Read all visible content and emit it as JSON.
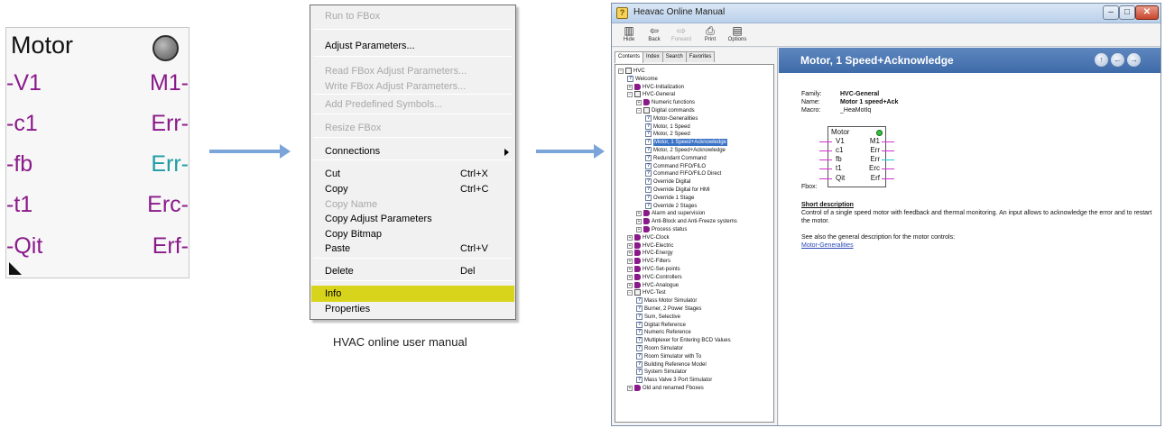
{
  "fbox": {
    "title": "Motor",
    "inputs": [
      "-V1",
      "-c1",
      "-fb",
      "-t1",
      "-Qit"
    ],
    "outputs": [
      {
        "label": "M1-",
        "color": "#8a1a8a"
      },
      {
        "label": "Err-",
        "color": "#8a1a8a"
      },
      {
        "label": "Err-",
        "color": "#1e9ca5"
      },
      {
        "label": "Erc-",
        "color": "#8a1a8a"
      },
      {
        "label": "Erf-",
        "color": "#8a1a8a"
      }
    ],
    "input_color": "#8a1a8a"
  },
  "context_menu": {
    "items": [
      {
        "label": "Run to FBox",
        "disabled": true
      },
      {
        "label": "Adjust Parameters...",
        "disabled": false
      },
      {
        "label": "Read FBox Adjust Parameters...",
        "disabled": true
      },
      {
        "label": "Write FBox Adjust Parameters...",
        "disabled": true
      },
      {
        "label": "Add Predefined Symbols...",
        "disabled": true
      },
      {
        "label": "Resize FBox",
        "disabled": true
      },
      {
        "label": "Connections",
        "disabled": false,
        "submenu": true
      },
      {
        "label": "Cut",
        "shortcut": "Ctrl+X",
        "disabled": false
      },
      {
        "label": "Copy",
        "shortcut": "Ctrl+C",
        "disabled": false
      },
      {
        "label": "Copy Name",
        "disabled": true
      },
      {
        "label": "Copy Adjust Parameters",
        "disabled": false
      },
      {
        "label": "Copy Bitmap",
        "disabled": false
      },
      {
        "label": "Paste",
        "shortcut": "Ctrl+V",
        "disabled": false
      },
      {
        "label": "Delete",
        "shortcut": "Del",
        "disabled": false
      },
      {
        "label": "Info",
        "disabled": false,
        "highlighted": true
      },
      {
        "label": "Properties",
        "disabled": false
      }
    ],
    "highlight_color": "#d8d41c"
  },
  "caption": "HVAC online user manual",
  "help_window": {
    "title": "Heavac Online Manual",
    "window_buttons": {
      "minimize": "–",
      "maximize": "□",
      "close": "✕"
    },
    "toolbar": [
      {
        "label": "Hide",
        "icon": "hide-icon",
        "glyph": "▥",
        "disabled": false
      },
      {
        "label": "Back",
        "icon": "back-arrow-icon",
        "glyph": "⇦",
        "disabled": false
      },
      {
        "label": "Forward",
        "icon": "forward-arrow-icon",
        "glyph": "⇨",
        "disabled": true
      },
      {
        "label": "Print",
        "icon": "printer-icon",
        "glyph": "⎙",
        "disabled": false
      },
      {
        "label": "Options",
        "icon": "options-icon",
        "glyph": "▤",
        "disabled": false
      }
    ],
    "tabs": [
      {
        "label": "Contents",
        "active": true
      },
      {
        "label": "Index",
        "active": false
      },
      {
        "label": "Search",
        "active": false
      },
      {
        "label": "Favorites",
        "active": false
      }
    ],
    "tree": [
      {
        "label": "HVC",
        "level": 0,
        "icon": "open",
        "exp": "−"
      },
      {
        "label": "Welcome",
        "level": 1,
        "icon": "page"
      },
      {
        "label": "HVC-Initialization",
        "level": 1,
        "icon": "book",
        "exp": "+"
      },
      {
        "label": "HVC-General",
        "level": 1,
        "icon": "open",
        "exp": "−"
      },
      {
        "label": "Numeric functions",
        "level": 2,
        "icon": "book",
        "exp": "+"
      },
      {
        "label": "Digital commands",
        "level": 2,
        "icon": "open",
        "exp": "−"
      },
      {
        "label": "Motor-Generalities",
        "level": 3,
        "icon": "page"
      },
      {
        "label": "Motor, 1 Speed",
        "level": 3,
        "icon": "page"
      },
      {
        "label": "Motor, 2 Speed",
        "level": 3,
        "icon": "page"
      },
      {
        "label": "Motor, 1 Speed+Acknowledge",
        "level": 3,
        "icon": "page",
        "selected": true
      },
      {
        "label": "Motor, 2 Speed+Acknowledge",
        "level": 3,
        "icon": "page"
      },
      {
        "label": "Redundant Command",
        "level": 3,
        "icon": "page"
      },
      {
        "label": "Command FIFO/FILO",
        "level": 3,
        "icon": "page"
      },
      {
        "label": "Command FIFO/FILO Direct",
        "level": 3,
        "icon": "page"
      },
      {
        "label": "Override Digital",
        "level": 3,
        "icon": "page"
      },
      {
        "label": "Override Digital for HMI",
        "level": 3,
        "icon": "page"
      },
      {
        "label": "Override 1 Stage",
        "level": 3,
        "icon": "page"
      },
      {
        "label": "Override 2 Stages",
        "level": 3,
        "icon": "page"
      },
      {
        "label": "Alarm and supervision",
        "level": 2,
        "icon": "book",
        "exp": "+"
      },
      {
        "label": "Anti-Block and Anti-Freeze systems",
        "level": 2,
        "icon": "book",
        "exp": "+"
      },
      {
        "label": "Process status",
        "level": 2,
        "icon": "book",
        "exp": "+"
      },
      {
        "label": "HVC-Clock",
        "level": 1,
        "icon": "book",
        "exp": "+"
      },
      {
        "label": "HVC-Electric",
        "level": 1,
        "icon": "book",
        "exp": "+"
      },
      {
        "label": "HVC-Energy",
        "level": 1,
        "icon": "book",
        "exp": "+"
      },
      {
        "label": "HVC-Filters",
        "level": 1,
        "icon": "book",
        "exp": "+"
      },
      {
        "label": "HVC-Set-points",
        "level": 1,
        "icon": "book",
        "exp": "+"
      },
      {
        "label": "HVC-Controllers",
        "level": 1,
        "icon": "book",
        "exp": "+"
      },
      {
        "label": "HVC-Analogue",
        "level": 1,
        "icon": "book",
        "exp": "+"
      },
      {
        "label": "HVC-Test",
        "level": 1,
        "icon": "open",
        "exp": "−"
      },
      {
        "label": "Mass Motor Simulator",
        "level": 2,
        "icon": "page"
      },
      {
        "label": "Burner, 2 Power Stages",
        "level": 2,
        "icon": "page"
      },
      {
        "label": "Sum, Selective",
        "level": 2,
        "icon": "page"
      },
      {
        "label": "Digital Reference",
        "level": 2,
        "icon": "page"
      },
      {
        "label": "Numeric Reference",
        "level": 2,
        "icon": "page"
      },
      {
        "label": "Multiplexer for Entering BCD Values",
        "level": 2,
        "icon": "page"
      },
      {
        "label": "Room Simulator",
        "level": 2,
        "icon": "page"
      },
      {
        "label": "Room Simulator with To",
        "level": 2,
        "icon": "page"
      },
      {
        "label": "Building Reference Model",
        "level": 2,
        "icon": "page"
      },
      {
        "label": "System Simulator",
        "level": 2,
        "icon": "page"
      },
      {
        "label": "Mass Valve 3 Port Simulator",
        "level": 2,
        "icon": "page"
      },
      {
        "label": "Old and renamed Fboxes",
        "level": 1,
        "icon": "book",
        "exp": "+"
      }
    ],
    "topic": {
      "title": "Motor, 1 Speed+Acknowledge",
      "family_label": "Family:",
      "family_value": "HVC-General",
      "name_label": "Name:",
      "name_value": "Motor 1 speed+Ack",
      "macro_label": "Macro:",
      "macro_value": "_HeaMotIq",
      "fbox_label": "Fbox:",
      "short_desc_head": "Short description",
      "short_desc": "Control of a single speed motor with feedback and thermal monitoring. An input allows to acknowledge the error and to restart the motor.",
      "see_also": "See also the general description for the motor controls:",
      "link": "Motor-Generalities",
      "mini_fbox": {
        "title": "Motor",
        "inputs": [
          "V1",
          "c1",
          "fb",
          "t1",
          "Qit"
        ],
        "outputs": [
          "M1",
          "Err",
          "Err",
          "Erc",
          "Erf"
        ],
        "input_lead_color": "#d62fd6",
        "output_lead_colors": [
          "#d62fd6",
          "#d62fd6",
          "#24c7d6",
          "#d62fd6",
          "#d62fd6"
        ]
      }
    }
  }
}
